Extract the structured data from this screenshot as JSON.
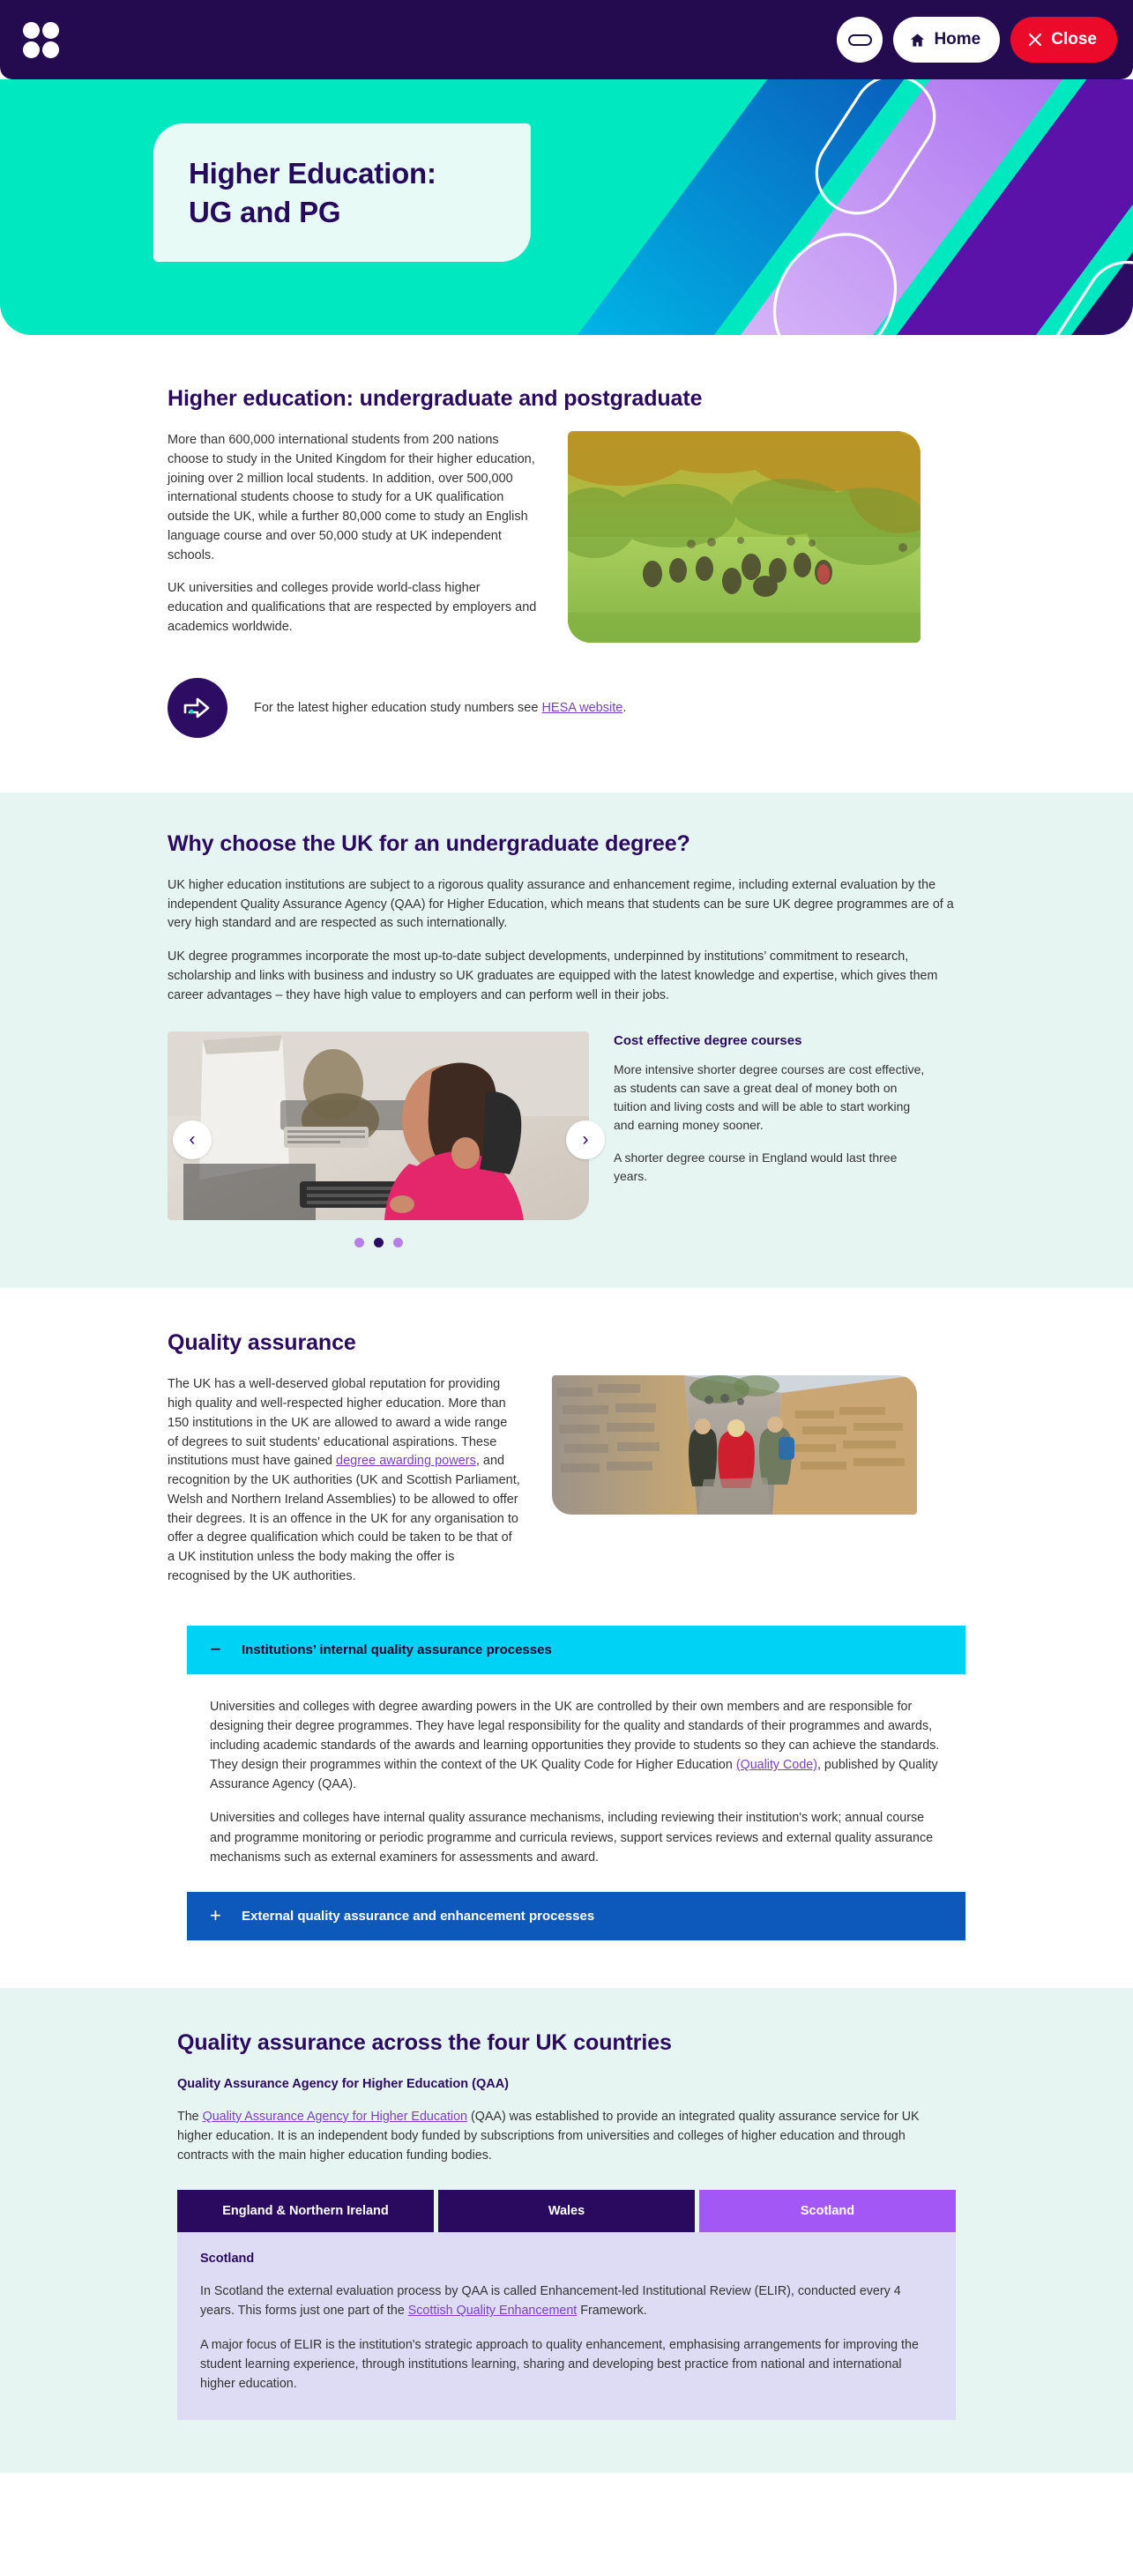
{
  "topbar": {
    "logo": "four-dot-logo",
    "minimize_label": "",
    "home_label": "Home",
    "close_label": "Close"
  },
  "hero": {
    "title_line1": "Higher Education:",
    "title_line2": "UG and PG",
    "background_colors": [
      "#00e8c0",
      "#0a72c8",
      "#b57fe8",
      "#5b12a8",
      "#2d0d63"
    ]
  },
  "section_intro": {
    "heading": "Higher education: undergraduate and postgraduate",
    "paragraphs": [
      "More than 600,000 international students from 200 nations choose to study in the United Kingdom for their higher education, joining over 2 million local students. In addition, over 500,000 international students choose to study for a UK qualification outside the UK, while a further 80,000 come to study an English language course and over 50,000 study at UK independent schools.",
      "UK universities and colleges provide world-class higher education and qualifications that are respected by employers and academics worldwide."
    ],
    "image_alt": "students-sitting-on-grass-in-park",
    "cta": {
      "icon": "arrow-right-icon",
      "text_before": "For the latest higher education study numbers see ",
      "link_text": "HESA website",
      "text_after": "."
    }
  },
  "section_why": {
    "heading": "Why choose the UK for an undergraduate degree?",
    "paragraphs": [
      "UK higher education institutions are subject to a rigorous quality assurance and enhancement regime, including external evaluation by the independent Quality Assurance Agency (QAA) for Higher Education, which means that students can be sure UK degree programmes are of a very high standard and are respected as such internationally.",
      "UK degree programmes incorporate the most up-to-date subject developments, underpinned by institutions’ commitment to research, scholarship and links with business and industry so UK graduates are equipped with the latest knowledge and expertise, which gives them career advantages – they have high value to employers and can perform well in their jobs."
    ],
    "carousel": {
      "image_alt": "student-working-at-computer-in-lab",
      "prev_label": "‹",
      "next_label": "›",
      "slide_title": "Cost effective degree courses",
      "slide_paragraphs": [
        "More intensive shorter degree courses are cost effective, as students can save a great deal of money both on tuition and living costs and will be able to start working and earning money sooner.",
        "A shorter degree course in England would last three years."
      ],
      "dot_count": 3,
      "active_dot_index": 1
    }
  },
  "section_quality": {
    "heading": "Quality assurance",
    "paragraph_part1": "The UK has a well-deserved global reputation for providing high quality and well-respected higher education. More than 150 institutions in the UK are allowed to award a wide range of degrees to suit students' educational aspirations. These institutions must have gained ",
    "link_text": "degree awarding powers",
    "paragraph_part2": ", and recognition by the UK authorities (UK and Scottish Parliament, Welsh and Northern Ireland Assemblies) to be allowed to offer their degrees. It is an offence in the UK for any organisation to offer a degree qualification which could be taken to be that of a UK institution unless the body making the offer is recognised by the UK authorities.",
    "image_alt": "students-walking-along-stone-walled-street",
    "accordion": [
      {
        "sign": "−",
        "title": "Institutions’ internal quality assurance processes",
        "state": "open",
        "body_part1": "Universities and colleges with degree awarding powers in the UK are controlled by their own members and are responsible for designing their degree programmes. They have legal responsibility for the quality and standards of their programmes and awards, including academic standards of the awards and learning opportunities they provide to students so they can achieve the standards. They design their programmes within the context of the UK Quality Code for Higher Education ",
        "body_link": "(Quality Code)",
        "body_part2": ", published by Quality Assurance Agency (QAA).",
        "body_paragraph2": "Universities and colleges have internal quality assurance mechanisms, including reviewing their institution's work; annual course and programme monitoring or periodic programme and curricula reviews, support services reviews and external quality assurance mechanisms such as external examiners for assessments and award."
      },
      {
        "sign": "+",
        "title": "External quality assurance and enhancement processes",
        "state": "closed"
      }
    ]
  },
  "section_four_countries": {
    "heading": "Quality assurance across the four UK countries",
    "subheading": "Quality Assurance Agency for Higher Education (QAA)",
    "intro_part1": "The ",
    "intro_link": "Quality Assurance Agency for Higher Education",
    "intro_part2": " (QAA) was established to provide an integrated quality assurance service for UK higher education. It is an independent body funded by subscriptions from universities and colleges of higher education and through contracts with the main higher education funding bodies.",
    "tabs": [
      {
        "label": "England & Northern Ireland",
        "active": false
      },
      {
        "label": "Wales",
        "active": false
      },
      {
        "label": "Scotland",
        "active": true
      }
    ],
    "panel": {
      "title": "Scotland",
      "p1_part1": "In Scotland the external evaluation process by QAA is called Enhancement-led Institutional Review (ELIR), conducted every 4 years. This forms just one part of the ",
      "p1_link": "Scottish Quality Enhancement",
      "p1_part2": " Framework.",
      "p2": "A major focus of ELIR is the institution's strategic approach to quality enhancement, emphasising arrangements for improving the student learning experience, through institutions learning, sharing and developing best practice from national and international higher education."
    }
  }
}
